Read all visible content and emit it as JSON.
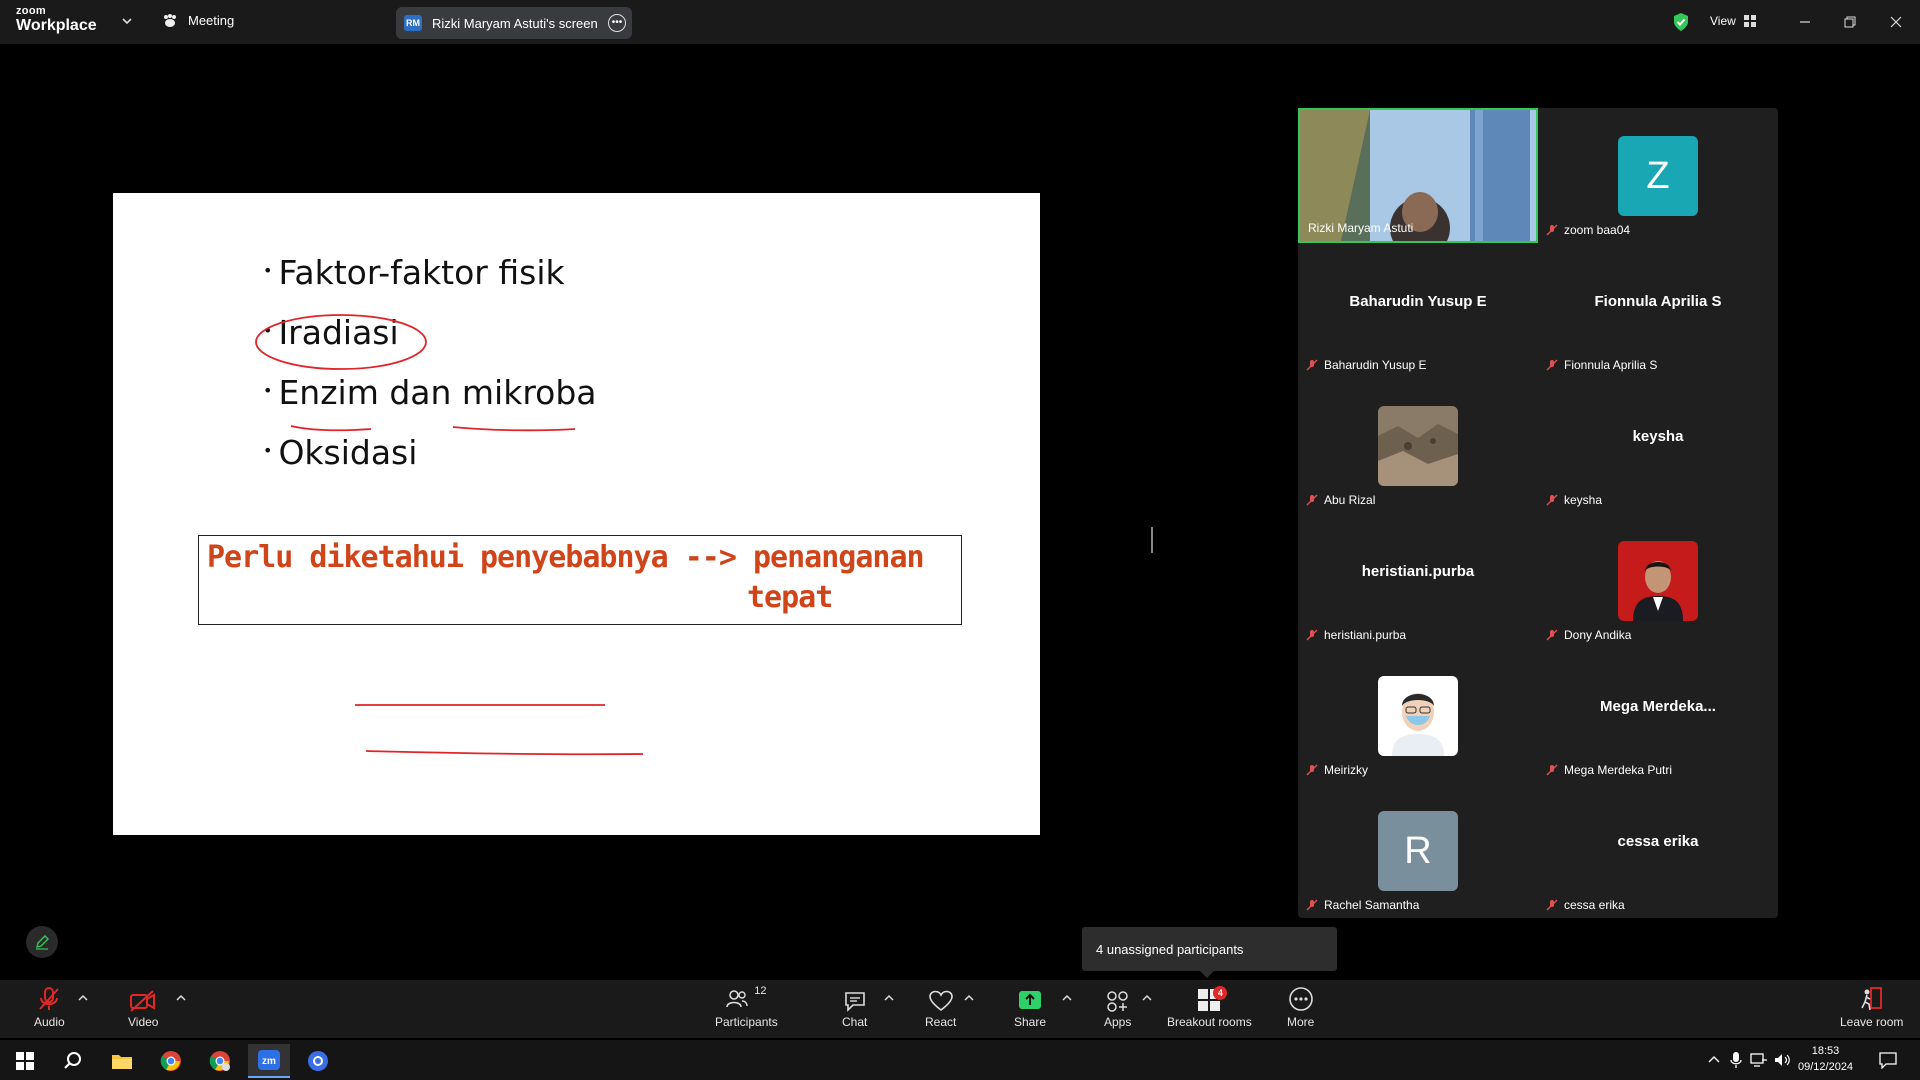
{
  "app": {
    "logo_small": "zoom",
    "logo_big": "Workplace",
    "meeting_label": "Meeting"
  },
  "screen_share": {
    "initials": "RM",
    "label": "Rizki Maryam Astuti's screen"
  },
  "topbar": {
    "view_label": "View"
  },
  "slide": {
    "bullets": [
      "Faktor-faktor fisik",
      "Iradiasi",
      "Enzim dan mikroba",
      "Oksidasi"
    ],
    "note_line1": "Perlu diketahui penyebabnya --> penanganan",
    "note_line2": "tepat"
  },
  "participants": [
    {
      "name": "Rizki Maryam Astuti",
      "display": "",
      "type": "video"
    },
    {
      "name": "zoom baa04",
      "display": "Z",
      "type": "letter",
      "color": "#1aa7b4"
    },
    {
      "name": "Baharudin Yusup E",
      "display": "Baharudin Yusup E",
      "type": "text"
    },
    {
      "name": "Fionnula Aprilia S",
      "display": "Fionnula Aprilia S",
      "type": "text"
    },
    {
      "name": "Abu Rizal",
      "display": "",
      "type": "photo-rocks"
    },
    {
      "name": "keysha",
      "display": "keysha",
      "type": "text"
    },
    {
      "name": "heristiani.purba",
      "display": "heristiani.purba",
      "type": "text"
    },
    {
      "name": "Dony Andika",
      "display": "",
      "type": "photo-person"
    },
    {
      "name": "Meirizky",
      "display": "",
      "type": "photo-cartoon"
    },
    {
      "name": "Mega Merdeka Putri",
      "display": "Mega  Merdeka...",
      "type": "text"
    },
    {
      "name": "Rachel Samantha",
      "display": "R",
      "type": "letter",
      "color": "#7a8f9c"
    },
    {
      "name": "cessa erika",
      "display": "cessa erika",
      "type": "text"
    }
  ],
  "unassigned_tooltip": "4 unassigned participants",
  "toolbar": {
    "audio": "Audio",
    "video": "Video",
    "participants": "Participants",
    "participants_count": "12",
    "chat": "Chat",
    "react": "React",
    "share": "Share",
    "apps": "Apps",
    "breakout": "Breakout rooms",
    "breakout_badge": "4",
    "more": "More",
    "leave": "Leave room"
  },
  "taskbar": {
    "time": "18:53",
    "date": "09/12/2024"
  },
  "colors": {
    "accent_green": "#35c759",
    "share_green": "#2fcf6a",
    "danger_red": "#e02828",
    "note_orange": "#d0441a"
  }
}
